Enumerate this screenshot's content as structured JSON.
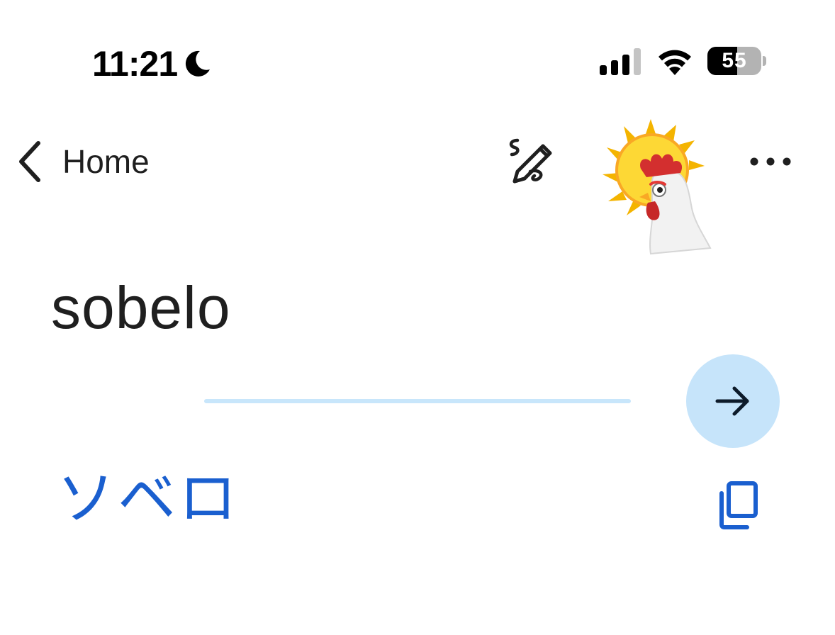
{
  "status_bar": {
    "time": "11:21",
    "focus_icon": "moon-icon",
    "signal_icon": "cellular-signal-icon",
    "wifi_icon": "wifi-icon",
    "battery_level": "55",
    "battery_fraction": 0.55
  },
  "nav": {
    "back_label": "Home",
    "handwriting_icon": "handwriting-pen-icon",
    "avatar_icon": "sun-rooster-avatar",
    "more_icon": "more-horizontal-icon"
  },
  "main": {
    "source_text": "sobelo",
    "translation_text": "ソベロ",
    "go_icon": "arrow-right-icon",
    "copy_icon": "copy-icon"
  },
  "colors": {
    "accent_blue": "#1a5fcf",
    "light_blue": "#c6e4fa",
    "divider_blue": "#c8e6fb",
    "text_dark": "#1f1f1f"
  }
}
